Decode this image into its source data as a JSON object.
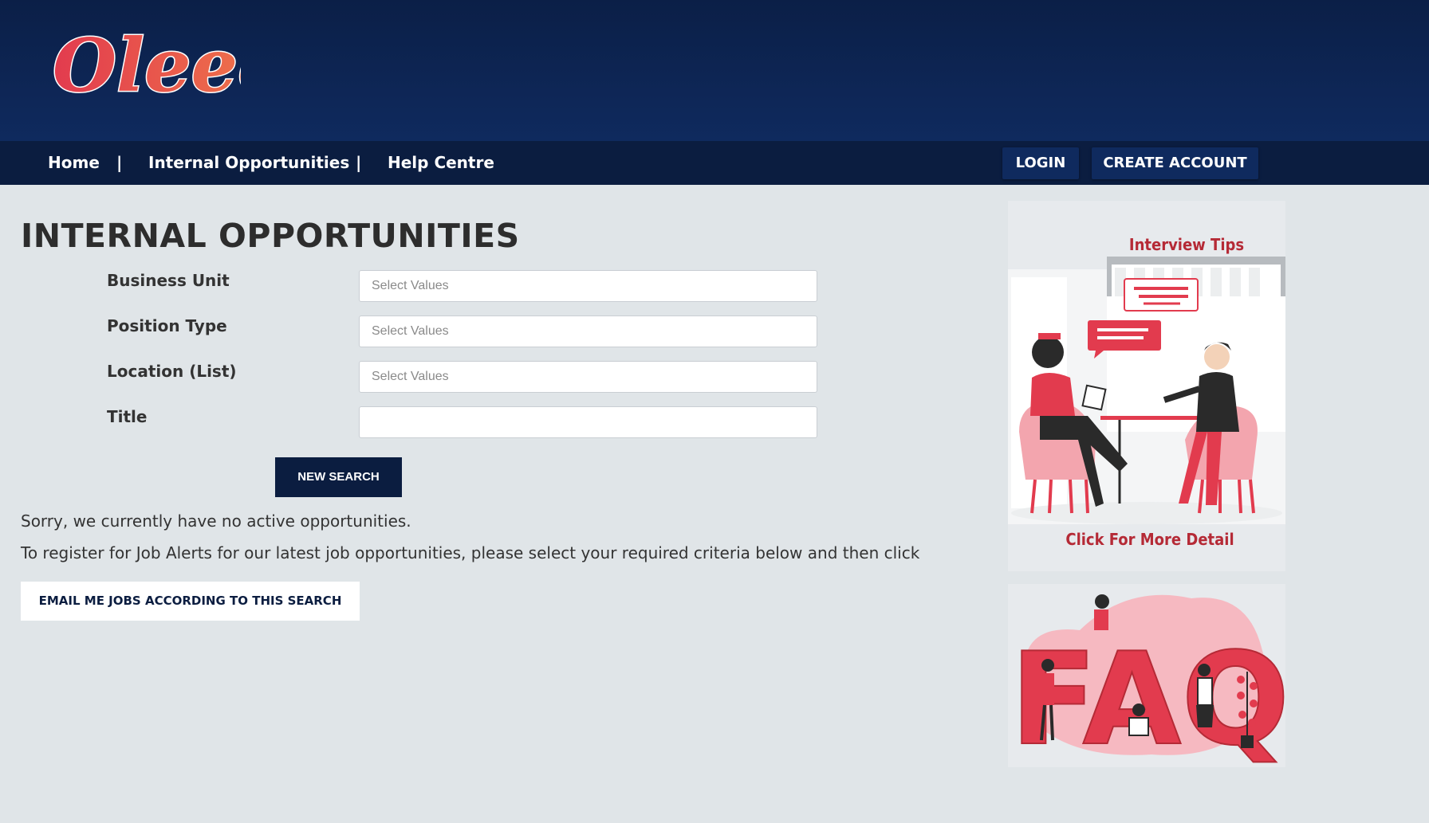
{
  "header": {
    "logo_text": "Oleeo"
  },
  "nav": {
    "links": [
      "Home",
      "Internal Opportunities",
      "Help Centre"
    ],
    "separator": "|",
    "login": "LOGIN",
    "create_account": "CREATE ACCOUNT"
  },
  "page": {
    "title": "INTERNAL OPPORTUNITIES",
    "fields": [
      {
        "label": "Business Unit",
        "placeholder": "Select Values"
      },
      {
        "label": "Position Type",
        "placeholder": "Select Values"
      },
      {
        "label": "Location (List)",
        "placeholder": "Select Values"
      },
      {
        "label": "Title",
        "placeholder": ""
      }
    ],
    "search_button": "NEW SEARCH",
    "no_results": "Sorry, we currently have no active opportunities.",
    "job_alert_text": "To register for Job Alerts for our latest job opportunities, please select your required criteria below and then click",
    "email_button": "EMAIL ME JOBS ACCORDING TO THIS SEARCH"
  },
  "sidebar": {
    "interview_title": "Interview Tips",
    "interview_cta": "Click For More Detail",
    "faq_text": "FAQ"
  },
  "colors": {
    "header_bg": "#0f2a5e",
    "nav_bg": "#0b1d40",
    "accent_red": "#e23b4e",
    "accent_pink": "#f3a5ae",
    "page_bg": "#e0e5e8"
  }
}
